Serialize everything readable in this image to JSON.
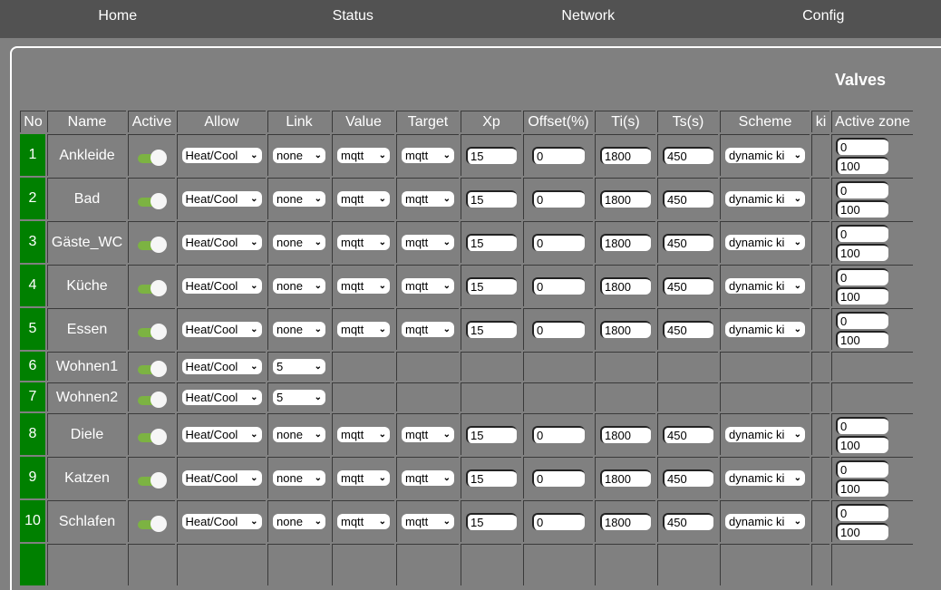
{
  "nav": [
    "Home",
    "Status",
    "Network",
    "Config"
  ],
  "title": "Valves",
  "headers": [
    "No",
    "Name",
    "Active",
    "Allow",
    "Link",
    "Value",
    "Target",
    "Xp",
    "Offset(%)",
    "Ti(s)",
    "Ts(s)",
    "Scheme",
    "ki",
    "Active zone"
  ],
  "rows": [
    {
      "no": "1",
      "name": "Ankleide",
      "active": true,
      "allow": "Heat/Cool",
      "link": "none",
      "value": "mqtt",
      "target": "mqtt",
      "xp": "15",
      "offset": "0",
      "ti": "1800",
      "ts": "450",
      "scheme": "dynamic ki",
      "zone_min": "0",
      "zone_max": "100"
    },
    {
      "no": "2",
      "name": "Bad",
      "active": true,
      "allow": "Heat/Cool",
      "link": "none",
      "value": "mqtt",
      "target": "mqtt",
      "xp": "15",
      "offset": "0",
      "ti": "1800",
      "ts": "450",
      "scheme": "dynamic ki",
      "zone_min": "0",
      "zone_max": "100"
    },
    {
      "no": "3",
      "name": "Gäste_WC",
      "active": true,
      "allow": "Heat/Cool",
      "link": "none",
      "value": "mqtt",
      "target": "mqtt",
      "xp": "15",
      "offset": "0",
      "ti": "1800",
      "ts": "450",
      "scheme": "dynamic ki",
      "zone_min": "0",
      "zone_max": "100"
    },
    {
      "no": "4",
      "name": "Küche",
      "active": true,
      "allow": "Heat/Cool",
      "link": "none",
      "value": "mqtt",
      "target": "mqtt",
      "xp": "15",
      "offset": "0",
      "ti": "1800",
      "ts": "450",
      "scheme": "dynamic ki",
      "zone_min": "0",
      "zone_max": "100"
    },
    {
      "no": "5",
      "name": "Essen",
      "active": true,
      "allow": "Heat/Cool",
      "link": "none",
      "value": "mqtt",
      "target": "mqtt",
      "xp": "15",
      "offset": "0",
      "ti": "1800",
      "ts": "450",
      "scheme": "dynamic ki",
      "zone_min": "0",
      "zone_max": "100"
    },
    {
      "no": "6",
      "name": "Wohnen1",
      "active": true,
      "allow": "Heat/Cool",
      "link": "5"
    },
    {
      "no": "7",
      "name": "Wohnen2",
      "active": true,
      "allow": "Heat/Cool",
      "link": "5"
    },
    {
      "no": "8",
      "name": "Diele",
      "active": true,
      "allow": "Heat/Cool",
      "link": "none",
      "value": "mqtt",
      "target": "mqtt",
      "xp": "15",
      "offset": "0",
      "ti": "1800",
      "ts": "450",
      "scheme": "dynamic ki",
      "zone_min": "0",
      "zone_max": "100"
    },
    {
      "no": "9",
      "name": "Katzen",
      "active": true,
      "allow": "Heat/Cool",
      "link": "none",
      "value": "mqtt",
      "target": "mqtt",
      "xp": "15",
      "offset": "0",
      "ti": "1800",
      "ts": "450",
      "scheme": "dynamic ki",
      "zone_min": "0",
      "zone_max": "100"
    },
    {
      "no": "10",
      "name": "Schlafen",
      "active": true,
      "allow": "Heat/Cool",
      "link": "none",
      "value": "mqtt",
      "target": "mqtt",
      "xp": "15",
      "offset": "0",
      "ti": "1800",
      "ts": "450",
      "scheme": "dynamic ki",
      "zone_min": "0",
      "zone_max": "100"
    }
  ],
  "colors": {
    "nav_bg": "#525252",
    "page_bg": "#808080",
    "no_cell": "#008000",
    "toggle_on": "#7cb342"
  }
}
